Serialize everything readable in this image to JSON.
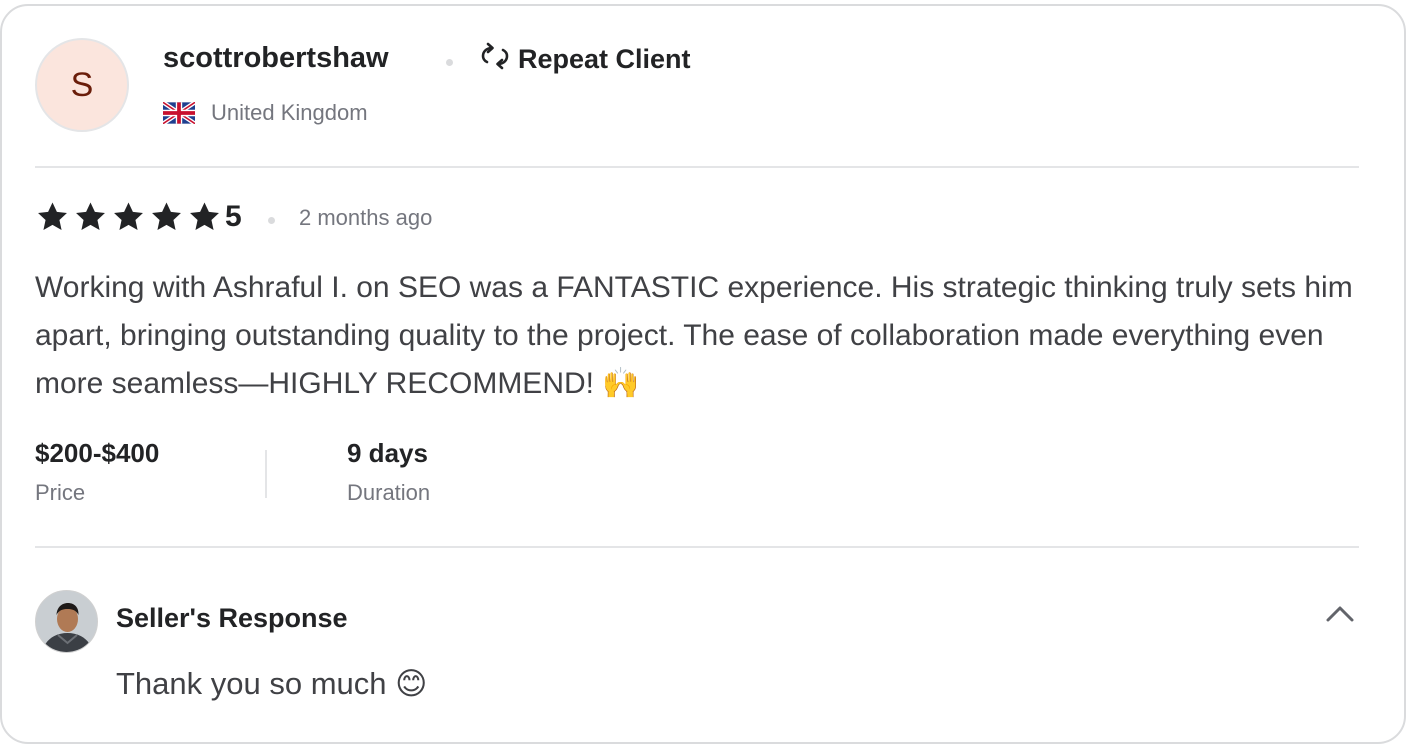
{
  "reviewer": {
    "initial": "S",
    "username": "scottrobertshaw",
    "badge_label": "Repeat Client",
    "badge_icon": "repeat-arrows-icon",
    "country": "United Kingdom",
    "flag_icon": "uk-flag-icon"
  },
  "review": {
    "rating": "5",
    "rating_value": 5,
    "rating_max": 5,
    "time_ago": "2 months ago",
    "text": "Working with Ashraful I. on SEO was a FANTASTIC experience. His strategic thinking truly sets him apart, bringing outstanding quality to the project. The ease of collaboration made everything even more seamless—HIGHLY RECOMMEND! 🙌"
  },
  "details": {
    "price_value": "$200-$400",
    "price_label": "Price",
    "duration_value": "9 days",
    "duration_label": "Duration"
  },
  "seller_response": {
    "title": "Seller's Response",
    "text": "Thank you so much 😊",
    "collapse_icon": "chevron-up-icon"
  },
  "colors": {
    "avatar_bg": "#fbe5dd",
    "avatar_text": "#6a1d0a",
    "muted_text": "#74767e",
    "divider": "#e4e5e7",
    "star": "#222325"
  }
}
